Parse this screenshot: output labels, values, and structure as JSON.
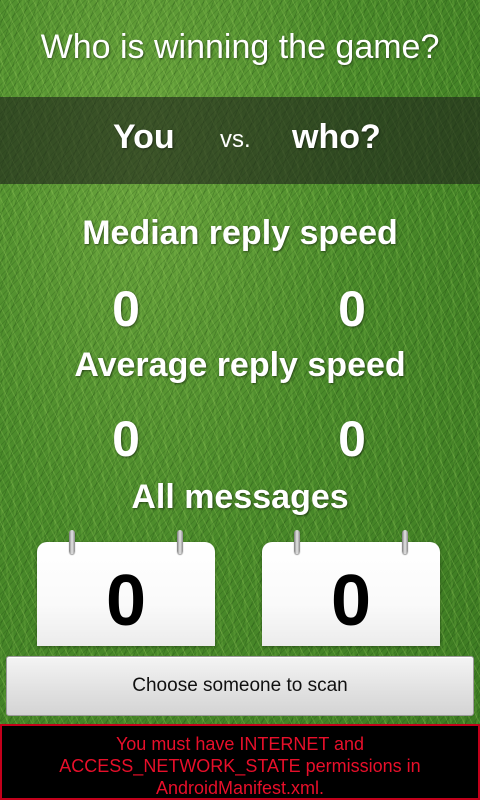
{
  "header": {
    "title": "Who is winning the game?"
  },
  "matchup": {
    "player_left": "You",
    "vs_label": "vs.",
    "player_right": "who?"
  },
  "stats": {
    "median": {
      "label": "Median reply speed",
      "left": "0",
      "right": "0"
    },
    "average": {
      "label": "Average reply speed",
      "left": "0",
      "right": "0"
    },
    "messages": {
      "label": "All messages",
      "left": "0",
      "right": "0"
    }
  },
  "actions": {
    "scan_label": "Choose someone to scan"
  },
  "error": {
    "message": "You must have INTERNET and ACCESS_NETWORK_STATE permissions in AndroidManifest.xml."
  },
  "colors": {
    "error_text": "#e80f2a",
    "error_border": "#c3001b"
  }
}
